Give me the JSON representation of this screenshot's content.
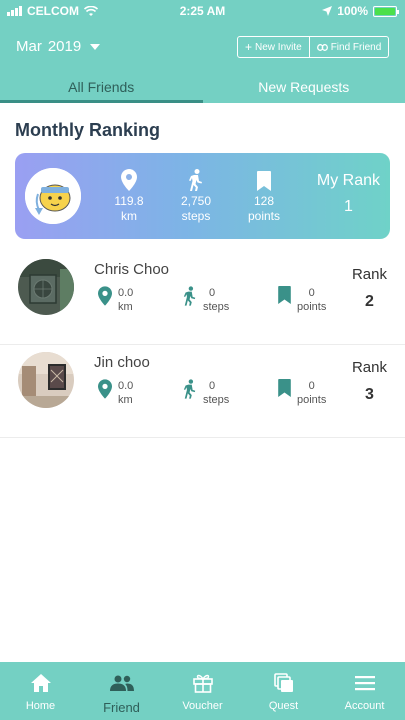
{
  "status_bar": {
    "carrier": "CELCOM",
    "time": "2:25 AM",
    "battery": "100%"
  },
  "header": {
    "month": "Mar",
    "year": "2019",
    "new_invite_label": "New Invite",
    "find_friend_label": "Find Friend"
  },
  "tabs": [
    {
      "label": "All Friends",
      "active": true
    },
    {
      "label": "New Requests",
      "active": false
    }
  ],
  "section_title": "Monthly Ranking",
  "my_stats": {
    "distance_value": "119.8",
    "distance_unit": "km",
    "steps_value": "2,750",
    "steps_unit": "steps",
    "points_value": "128",
    "points_unit": "points",
    "rank_label": "My Rank",
    "rank_value": "1"
  },
  "friends": [
    {
      "name": "Chris Choo",
      "distance_value": "0.0",
      "distance_unit": "km",
      "steps_value": "0",
      "steps_unit": "steps",
      "points_value": "0",
      "points_unit": "points",
      "rank_label": "Rank",
      "rank_value": "2"
    },
    {
      "name": "Jin choo",
      "distance_value": "0.0",
      "distance_unit": "km",
      "steps_value": "0",
      "steps_unit": "steps",
      "points_value": "0",
      "points_unit": "points",
      "rank_label": "Rank",
      "rank_value": "3"
    }
  ],
  "bottom_nav": [
    {
      "label": "Home",
      "icon": "home-icon"
    },
    {
      "label": "Friend",
      "icon": "friends-icon",
      "active": true
    },
    {
      "label": "Voucher",
      "icon": "gift-icon"
    },
    {
      "label": "Quest",
      "icon": "quest-icon"
    },
    {
      "label": "Account",
      "icon": "menu-icon"
    }
  ],
  "colors": {
    "primary": "#74d0c3",
    "accent_dark": "#3a8f86",
    "icon_teal": "#3a9189"
  }
}
